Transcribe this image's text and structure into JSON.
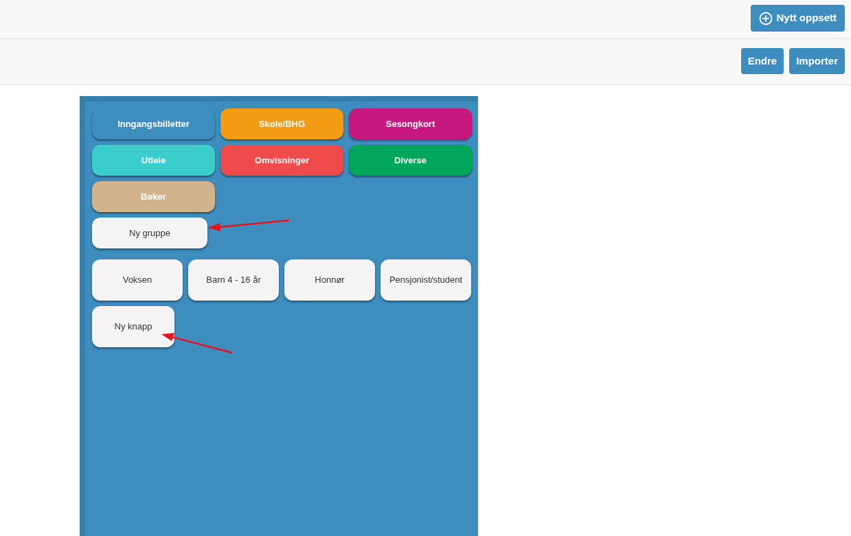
{
  "header": {
    "new_layout_button": "Nytt oppsett"
  },
  "toolbar": {
    "buttons": [
      "Endre",
      "Importer"
    ]
  },
  "groups": [
    {
      "label": "Inngangsbilletter",
      "color": "#3d8dbf"
    },
    {
      "label": "Skole/BHG",
      "color": "#f29b13"
    },
    {
      "label": "Sesongkort",
      "color": "#c7187f"
    },
    {
      "label": "Utleie",
      "color": "#3bcdcc"
    },
    {
      "label": "Omvisninger",
      "color": "#ef4b4b"
    },
    {
      "label": "Diverse",
      "color": "#00a65a"
    },
    {
      "label": "Bøker",
      "color": "#d1b38c"
    }
  ],
  "new_group_button": "Ny gruppe",
  "products": [
    "Voksen",
    "Barn 4 - 16 år",
    "Honnør",
    "Pensjonist/student"
  ],
  "new_product_button": "Ny knapp"
}
